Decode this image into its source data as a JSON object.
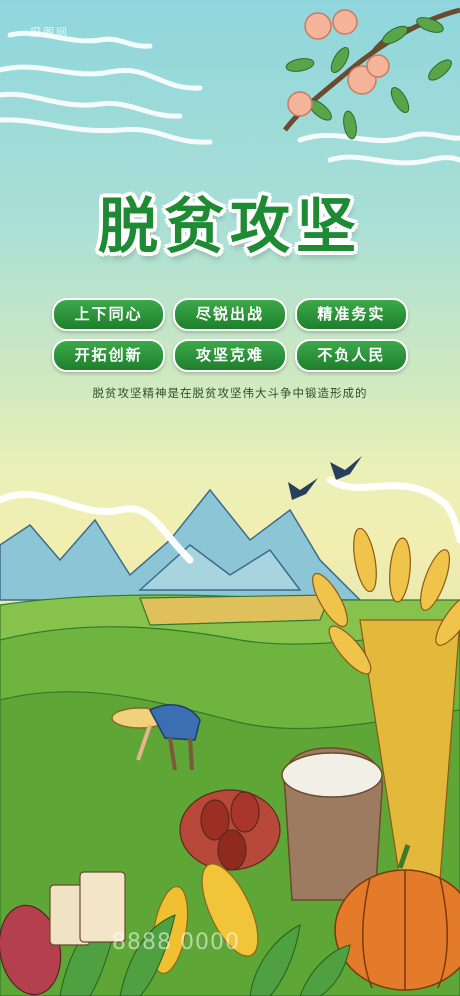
{
  "poster": {
    "watermark_logo": "摄图网",
    "title": "脱贫攻坚",
    "slogans": [
      "上下同心",
      "尽锐出战",
      "精准务实",
      "开拓创新",
      "攻坚克难",
      "不负人民"
    ],
    "subtitle": "脱贫攻坚精神是在脱贫攻坚伟大斗争中锻造形成的",
    "phone_watermark": "8888 0000"
  },
  "colors": {
    "title_green": "#1f8a34",
    "pill_green": "#2e9a3c",
    "sky": "#8fd6dc"
  }
}
